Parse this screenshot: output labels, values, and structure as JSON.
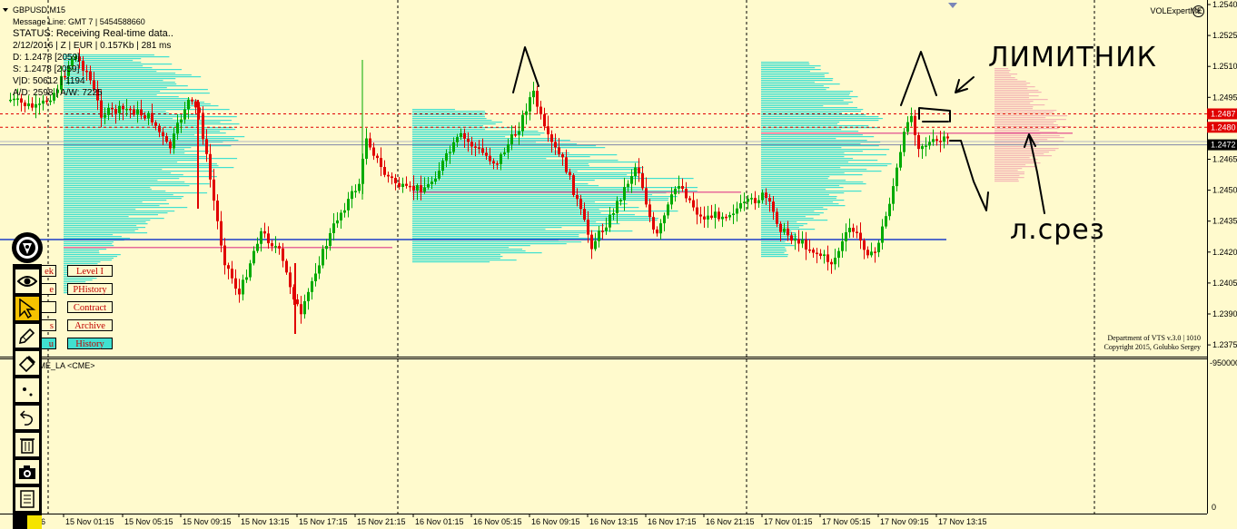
{
  "symbol_header": "GBPUSD,M15",
  "info_lines": {
    "message": "Message Line: GMT 7 | 5454588660",
    "status": "STATUS:  Receiving Real-time data..",
    "meta": "2/12/2016 | Z | EUR | 0.157Kb | 281 ms",
    "d": "D: 1.2478  [2059]",
    "s": "S: 1.2478  [2059]",
    "vd": "V|D: 50612 | 1194",
    "aw": "A/D: 2598 | A/W: 7225"
  },
  "indicator_name": "VOLExpertME",
  "subwindow_title": "CME_LA <CME>",
  "copyright": [
    "Department of VTS  v.3.0 | 1010",
    "Copyright 2015, Golubko Sergey"
  ],
  "buttons_visible": [
    "Level I",
    "PHistory",
    "Contract",
    "Archive",
    "History"
  ],
  "buttons_hidden_fragments": [
    "ek",
    "e",
    "",
    "s",
    "u"
  ],
  "annotations": {
    "top_right": "ЛИМИТНИК",
    "lower_right": "л.срез"
  },
  "price_axis": {
    "ticks": [
      "1.2540",
      "1.2525",
      "1.2510",
      "1.2495",
      "1.2480",
      "1.2465",
      "1.2450",
      "1.2435",
      "1.2420",
      "1.2405",
      "1.2390",
      "1.2375"
    ],
    "tags": [
      {
        "label": "1.2487",
        "color": "#e00000"
      },
      {
        "label": "1.2480",
        "color": "#e00000"
      },
      {
        "label": "1.2472",
        "color": "#000000"
      }
    ]
  },
  "volume_axis": {
    "top": "-950000",
    "bottom": "0"
  },
  "time_axis": [
    "016",
    "15 Nov 01:15",
    "15 Nov 05:15",
    "15 Nov 09:15",
    "15 Nov 13:15",
    "15 Nov 17:15",
    "15 Nov 21:15",
    "16 Nov 01:15",
    "16 Nov 05:15",
    "16 Nov 09:15",
    "16 Nov 13:15",
    "16 Nov 17:15",
    "16 Nov 21:15",
    "17 Nov 01:15",
    "17 Nov 05:15",
    "17 Nov 09:15",
    "17 Nov 13:15"
  ],
  "colors": {
    "background": "#fffacd",
    "bull": "#00aa00",
    "bear": "#e00000",
    "profile": "#40e0d0",
    "level_blue": "#1c3cc8",
    "level_red": "#e00000"
  }
}
